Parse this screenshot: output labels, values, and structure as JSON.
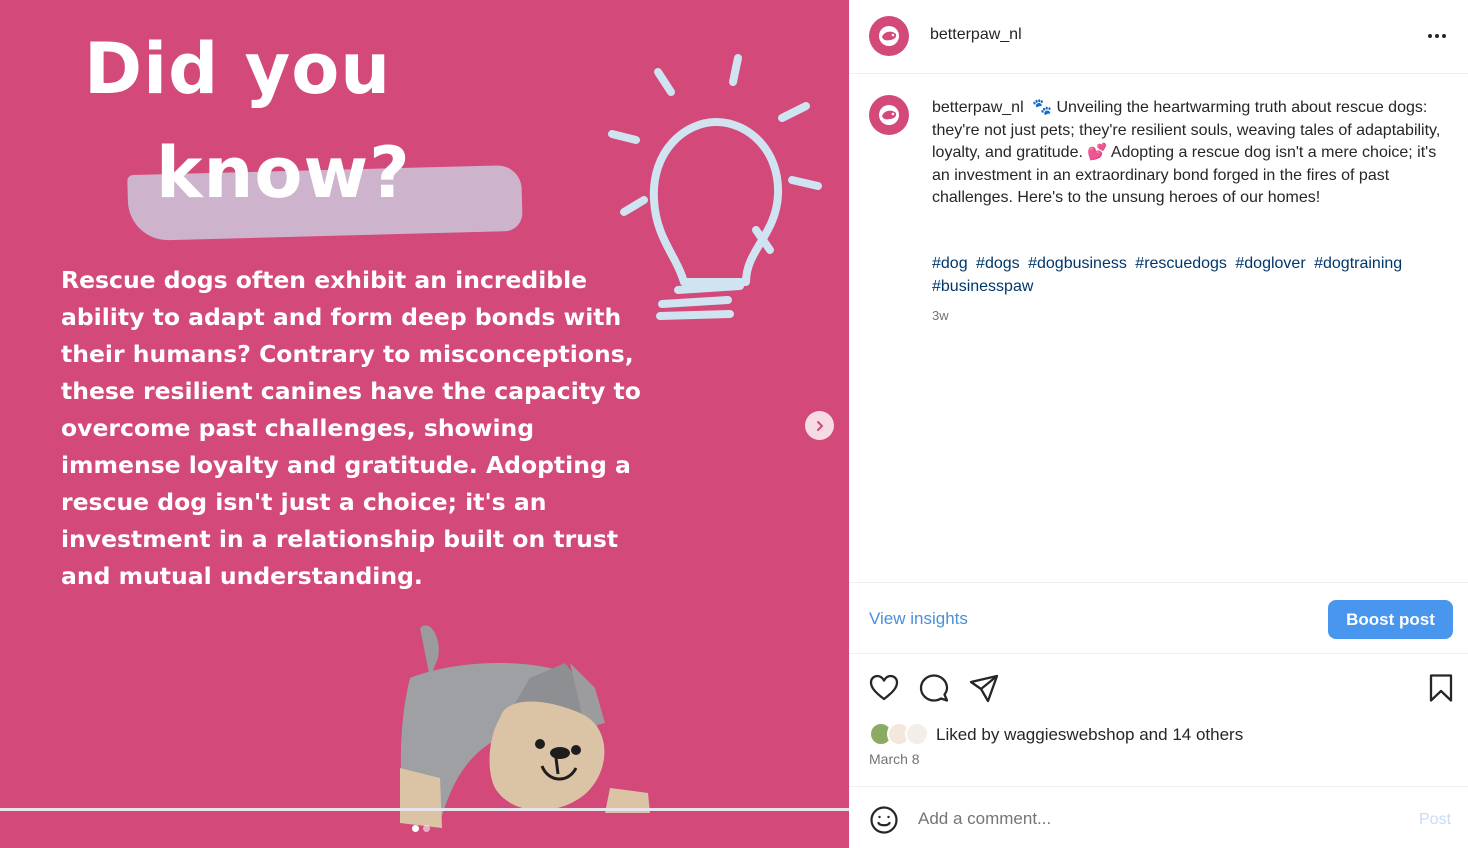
{
  "media": {
    "headline_line1": "Did you",
    "headline_line2": "know?",
    "body": "Rescue dogs often exhibit an incredible ability to adapt and form deep bonds with their humans? Contrary to misconceptions, these resilient canines have the capacity to overcome past challenges, showing immense loyalty and gratitude. Adopting a rescue dog isn't just a choice; it's an investment in a relationship built on trust and mutual understanding.",
    "background_color": "#d2497a",
    "carousel": {
      "slides": 2,
      "active_slide": 1
    }
  },
  "header": {
    "username": "betterpaw_nl",
    "more_icon": "more-horizontal-icon"
  },
  "caption": {
    "username": "betterpaw_nl",
    "text": "🐾 Unveiling the heartwarming truth about rescue dogs: they're not just pets; they're resilient souls, weaving tales of adaptability, loyalty, and gratitude. 💕 Adopting a rescue dog isn't a mere choice; it's an investment in an extraordinary bond forged in the fires of past challenges. Here's to the unsung heroes of our homes!",
    "hashtags": [
      "#dog",
      "#dogs",
      "#dogbusiness",
      "#rescuedogs",
      "#doglover",
      "#dogtraining",
      "#businesspaw"
    ],
    "time": "3w"
  },
  "insights": {
    "view_label": "View insights",
    "boost_label": "Boost post"
  },
  "actions": [
    "heart-icon",
    "comment-icon",
    "share-icon",
    "bookmark-icon"
  ],
  "likes": {
    "prefix": "Liked by",
    "user": "waggieswebshop",
    "middle": "and",
    "others": "14 others"
  },
  "date": "March 8",
  "comment": {
    "placeholder": "Add a comment...",
    "post_label": "Post"
  },
  "colors": {
    "brand_pink": "#d2497a",
    "link_blue": "#00376b",
    "accent_blue": "#4996ee"
  }
}
